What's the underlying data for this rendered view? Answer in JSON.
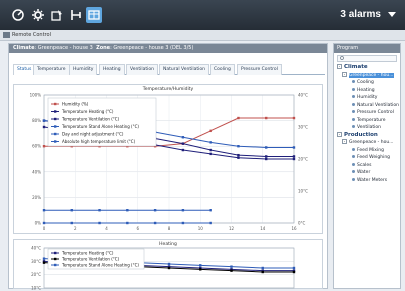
{
  "toolbar": {
    "icons": [
      "gauge-icon",
      "gear-icon",
      "settings-cog-icon",
      "chart-icon",
      "grid-icon"
    ],
    "alarms_label": "3 alarms"
  },
  "subbar": {
    "label": "Remote Control"
  },
  "main": {
    "header_climate_label": "Climate",
    "header_climate_value": "Greenpeace - house 3",
    "header_zone_label": "Zone",
    "header_zone_value": "Greenpeace - house 3 (DEL 3/5)",
    "tabs": [
      {
        "label": "Status",
        "active": true
      },
      {
        "label": "Temperature",
        "active": false
      },
      {
        "label": "Humidity",
        "active": false
      },
      {
        "label": "Heating",
        "active": false
      },
      {
        "label": "Ventilation",
        "active": false
      },
      {
        "label": "Natural Ventilation",
        "active": false
      },
      {
        "label": "Cooling",
        "active": false
      },
      {
        "label": "Pressure Control",
        "active": false
      }
    ]
  },
  "chart_data": [
    {
      "type": "line",
      "title": "Temperature/Humidity",
      "y_left_ticks": [
        "100%",
        "80%",
        "60%",
        "40%",
        "20%",
        "0%"
      ],
      "y_right_ticks": [
        "40°C",
        "30°C",
        "20°C",
        "10°C",
        "0°C"
      ],
      "x_ticks": [
        "0",
        "2",
        "4",
        "6",
        "8",
        "10",
        "12",
        "14",
        "16"
      ],
      "x": [
        0,
        2,
        4,
        6,
        8,
        10,
        12,
        14,
        16
      ],
      "ylim_left": [
        0,
        100
      ],
      "series": [
        {
          "name": "Humidity (%)",
          "color": "#c0504d",
          "values": [
            60,
            60,
            60,
            60,
            60,
            62,
            72,
            82,
            82,
            82
          ]
        },
        {
          "name": "Temperature Heating (°C)",
          "color": "#1f1f7a",
          "values": [
            80,
            77,
            73,
            69,
            66,
            62,
            57,
            53,
            52,
            52
          ]
        },
        {
          "name": "Temperature Ventilation (°C)",
          "color": "#1f1f7a",
          "values": [
            75,
            72,
            68,
            64,
            61,
            57,
            54,
            51,
            50,
            50
          ]
        },
        {
          "name": "Temperature Stand Alone Heating (°C)",
          "color": "#2e5cb8",
          "values": [
            80,
            79,
            77,
            74,
            71,
            67,
            63,
            60,
            59,
            59
          ]
        },
        {
          "name": "Day and night adjustment (°C)",
          "color": "#2e5cb8",
          "values": [
            10,
            10,
            10,
            10,
            10,
            10,
            10
          ]
        },
        {
          "name": "Absolute high temperature limit (°C)",
          "color": "#2e5cb8",
          "values": [
            0,
            0,
            0,
            0,
            0,
            0,
            0
          ]
        }
      ],
      "legend": "top-left"
    },
    {
      "type": "line",
      "title": "Heating",
      "y_ticks": [
        "40°C",
        "30°C",
        "20°C",
        "10°C"
      ],
      "series": [
        {
          "name": "Temperature Heating (°C)",
          "color": "#1f1f7a",
          "values": [
            30,
            29,
            28,
            27,
            26,
            25,
            24,
            23,
            23
          ]
        },
        {
          "name": "Temperature Ventilation (°C)",
          "color": "#000000",
          "values": [
            29,
            28,
            27,
            26,
            25,
            24,
            23,
            22,
            22
          ]
        },
        {
          "name": "Temperature Stand Alone Heating (°C)",
          "color": "#2e5cb8",
          "values": [
            32,
            31,
            30,
            29,
            28,
            27,
            26,
            25,
            25
          ]
        }
      ],
      "legend": "top-left"
    }
  ],
  "right": {
    "header": "Program",
    "items": [
      {
        "label": "Climate",
        "kind": "group"
      },
      {
        "label": "Greenpeace - hou...",
        "kind": "selected"
      },
      {
        "label": "Cooling",
        "kind": "leaf"
      },
      {
        "label": "Heating",
        "kind": "leaf"
      },
      {
        "label": "Humidity",
        "kind": "leaf"
      },
      {
        "label": "Natural Ventilation",
        "kind": "leaf"
      },
      {
        "label": "Pressure Control",
        "kind": "leaf"
      },
      {
        "label": "Temperature",
        "kind": "leaf"
      },
      {
        "label": "Ventilation",
        "kind": "leaf"
      },
      {
        "label": "Production",
        "kind": "group"
      },
      {
        "label": "Greenpeace - hou...",
        "kind": "sub"
      },
      {
        "label": "Feed Mixing",
        "kind": "leaf"
      },
      {
        "label": "Feed Weighing",
        "kind": "leaf"
      },
      {
        "label": "Scales",
        "kind": "leaf"
      },
      {
        "label": "Water",
        "kind": "leaf"
      },
      {
        "label": "Water Meters",
        "kind": "leaf"
      }
    ]
  }
}
